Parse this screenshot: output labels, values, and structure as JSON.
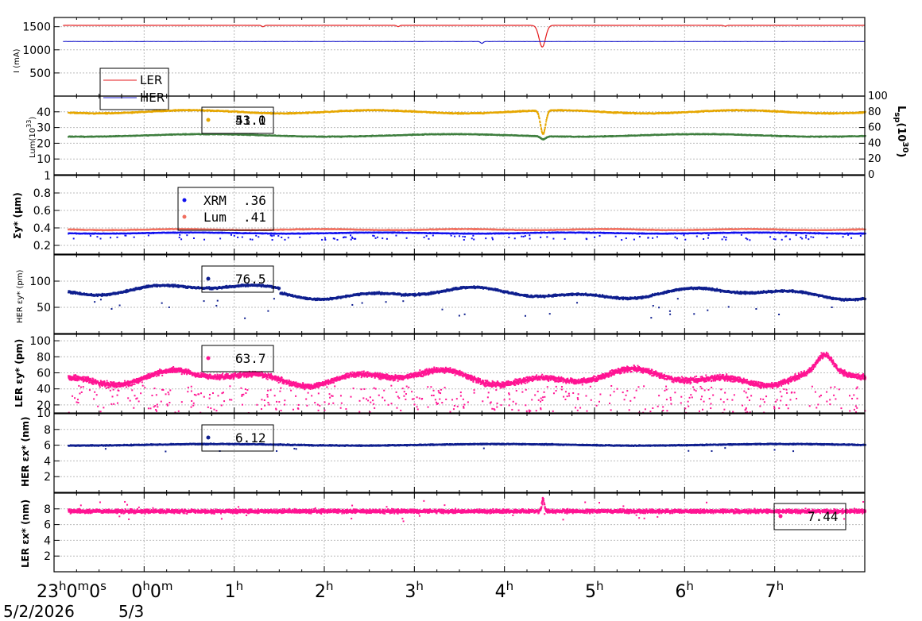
{
  "colors": {
    "ler_current": "#e41a1c",
    "her_current": "#1f1fcc",
    "lum_specific": "#e6a700",
    "luminosity": "#3f7f3f",
    "xrm": "#1111ee",
    "lum_sigma": "#f07060",
    "her_emit": "#0f1f8f",
    "ler_emit": "#ff1493"
  },
  "x_axis": {
    "tick_labels": [
      "23",
      "0",
      "1",
      "2",
      "3",
      "4",
      "5",
      "6",
      "7"
    ],
    "first_tick_suffix": "0m0s",
    "second_tick_suffix": "0m",
    "hour_superscript": "h",
    "min_sup": "m",
    "sec_sup": "s",
    "date_left": "5/2/2026",
    "date_right": "5/3",
    "range_hours": [
      -1,
      8.0
    ]
  },
  "chart_data": [
    {
      "type": "line",
      "ylabel": "I (mA)",
      "yticks": [
        "500",
        "1000",
        "1500"
      ],
      "ylim": [
        0,
        1700
      ],
      "legend": [
        "LER",
        "HER"
      ],
      "series": [
        {
          "name": "LER",
          "values": [
            1530
          ],
          "dips_hours": [
            1.32,
            2.82,
            4.42,
            6.45
          ],
          "dip_depth": [
            30,
            30,
            470,
            20
          ]
        },
        {
          "name": "HER",
          "values": [
            1180
          ],
          "dips_hours": [
            3.75
          ],
          "dip_depth": [
            40
          ]
        }
      ]
    },
    {
      "type": "scatter",
      "ylabel": "Lum(10",
      "ylabel_sup": "33",
      "ylabel_end": ")",
      "yticks": [
        "10",
        "20",
        "30",
        "40"
      ],
      "ylim": [
        0,
        50
      ],
      "y2label": "L",
      "y2label_sub": "sp",
      "y2label_mid": "(10",
      "y2label_sup": "30",
      "y2label_end": ")",
      "y2ticks": [
        "0",
        "20",
        "40",
        "60",
        "80",
        "100"
      ],
      "y2lim": [
        0,
        100
      ],
      "legend_values": [
        "53.0",
        "41.1"
      ],
      "series": [
        {
          "name": "Lsp",
          "level": 81
        },
        {
          "name": "Lum",
          "level": 25.5
        }
      ]
    },
    {
      "type": "scatter",
      "ylabel": "Σy* (μm)",
      "yticks": [
        "0.2",
        "0.4",
        "0.6",
        "0.8",
        "1"
      ],
      "ylim": [
        0.1,
        1.0
      ],
      "legend": [
        {
          "name": "XRM",
          "value": ".36"
        },
        {
          "name": "Lum",
          "value": ".41"
        }
      ],
      "series": [
        {
          "name": "XRM",
          "level": 0.35
        },
        {
          "name": "Lum",
          "level": 0.39
        }
      ]
    },
    {
      "type": "scatter",
      "ylabel": "HER εy* (pm)",
      "yticks": [
        "50",
        "100"
      ],
      "ylim": [
        0,
        150
      ],
      "legend_value": "76.5",
      "series": [
        {
          "name": "HER",
          "level": 78
        }
      ]
    },
    {
      "type": "scatter",
      "ylabel": "LER εy* (pm)",
      "yticks": [
        "10",
        "20",
        "40",
        "60",
        "80",
        "100"
      ],
      "ylim": [
        10,
        108
      ],
      "legend_value": "63.7",
      "series": [
        {
          "name": "LER",
          "level": 55
        }
      ]
    },
    {
      "type": "scatter",
      "ylabel": "HER εx* (nm)",
      "yticks": [
        "2",
        "4",
        "6",
        "8"
      ],
      "ylim": [
        0,
        10
      ],
      "legend_value": "6.12",
      "series": [
        {
          "name": "HER",
          "level": 6.15
        }
      ]
    },
    {
      "type": "scatter",
      "ylabel": "LER εx* (nm)",
      "yticks": [
        "2",
        "4",
        "6",
        "8"
      ],
      "ylim": [
        0,
        10
      ],
      "legend_value": "7.44",
      "series": [
        {
          "name": "LER",
          "level": 7.8
        }
      ]
    }
  ]
}
